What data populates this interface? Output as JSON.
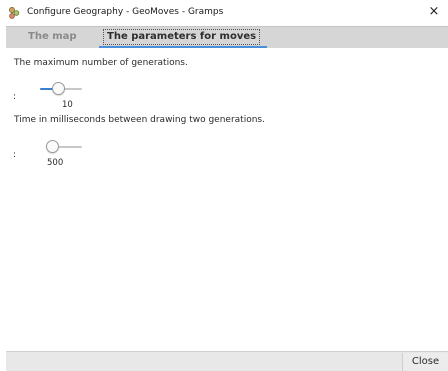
{
  "window": {
    "title": "Configure Geography - GeoMoves - Gramps",
    "close_glyph": "×",
    "app_icon": "gramps-tree-icon"
  },
  "tabs": [
    {
      "label": "The map",
      "active": false
    },
    {
      "label": "The parameters for moves",
      "active": true
    }
  ],
  "accent_color": "#4a90d9",
  "settings": {
    "generations": {
      "description": "The maximum number of generations.",
      "colon": ":",
      "value": "10",
      "level": 0.2
    },
    "time": {
      "description": "Time in milliseconds between drawing two generations.",
      "colon": ":",
      "value": "500",
      "level": 0.0
    }
  },
  "buttons": {
    "close_label": "Close"
  }
}
